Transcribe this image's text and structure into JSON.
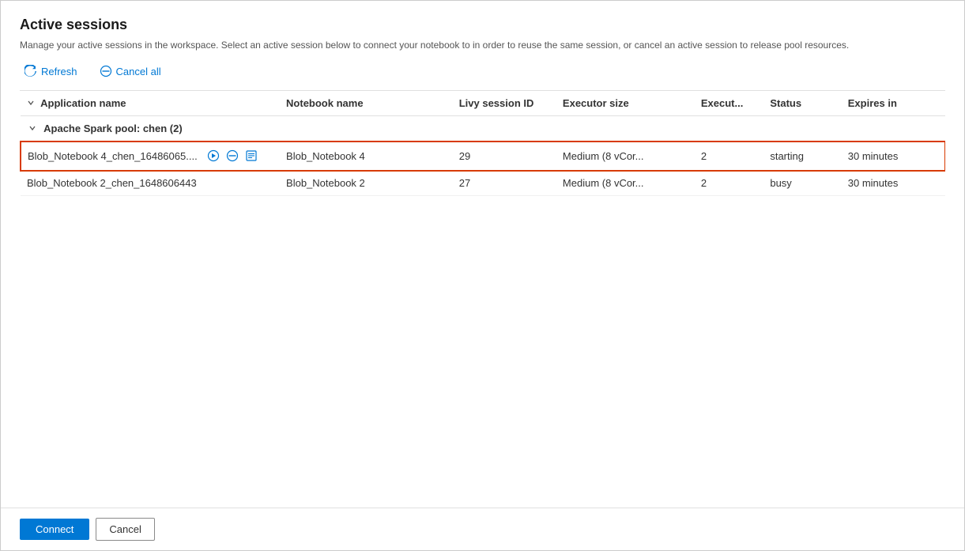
{
  "page": {
    "title": "Active sessions",
    "description": "Manage your active sessions in the workspace. Select an active session below to connect your notebook to in order to reuse the same session, or cancel an active session to release pool resources."
  },
  "toolbar": {
    "refresh_label": "Refresh",
    "cancel_all_label": "Cancel all"
  },
  "table": {
    "columns": [
      {
        "key": "app_name",
        "label": "Application name"
      },
      {
        "key": "notebook_name",
        "label": "Notebook name"
      },
      {
        "key": "livy_session_id",
        "label": "Livy session ID"
      },
      {
        "key": "executor_size",
        "label": "Executor size"
      },
      {
        "key": "executor_count",
        "label": "Execut..."
      },
      {
        "key": "status",
        "label": "Status"
      },
      {
        "key": "expires_in",
        "label": "Expires in"
      }
    ],
    "groups": [
      {
        "group_name": "Apache Spark pool: chen (2)",
        "rows": [
          {
            "app_name": "Blob_Notebook 4_chen_16486065....",
            "notebook_name": "Blob_Notebook 4",
            "livy_session_id": "29",
            "executor_size": "Medium (8 vCor...",
            "executor_count": "2",
            "status": "starting",
            "expires_in": "30 minutes",
            "selected": true
          },
          {
            "app_name": "Blob_Notebook 2_chen_1648606443",
            "notebook_name": "Blob_Notebook 2",
            "livy_session_id": "27",
            "executor_size": "Medium (8 vCor...",
            "executor_count": "2",
            "status": "busy",
            "expires_in": "30 minutes",
            "selected": false
          }
        ]
      }
    ]
  },
  "footer": {
    "connect_label": "Connect",
    "cancel_label": "Cancel"
  }
}
